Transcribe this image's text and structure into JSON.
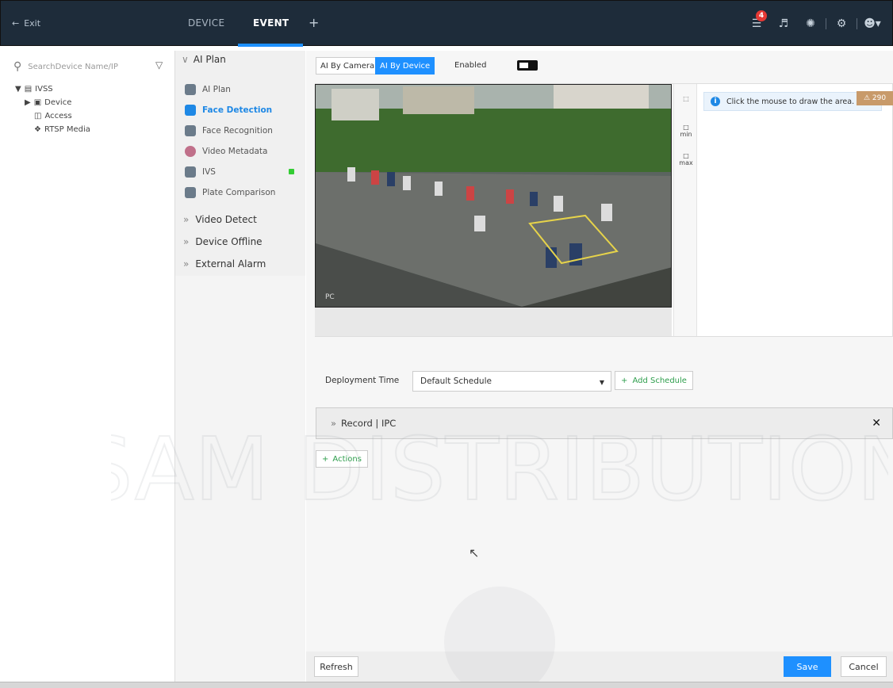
{
  "topbar": {
    "exit_label": "Exit",
    "tabs": [
      {
        "label": "DEVICE",
        "active": false
      },
      {
        "label": "EVENT",
        "active": true
      }
    ],
    "notification_count": "4"
  },
  "left_panel": {
    "search_placeholder": "SearchDevice Name/IP",
    "tree": {
      "root": "IVSS",
      "items": [
        "Device",
        "Access",
        "RTSP Media"
      ]
    }
  },
  "mid_panel": {
    "ai_plan_header": "AI Plan",
    "menu": [
      {
        "label": "AI Plan",
        "icon": "ai-plan-icon"
      },
      {
        "label": "Face Detection",
        "icon": "face-detection-icon",
        "active": true
      },
      {
        "label": "Face Recognition",
        "icon": "face-recognition-icon"
      },
      {
        "label": "Video Metadata",
        "icon": "video-metadata-icon"
      },
      {
        "label": "IVS",
        "icon": "ivs-icon"
      },
      {
        "label": "Plate Comparison",
        "icon": "plate-comparison-icon"
      }
    ],
    "sections": [
      "Video Detect",
      "Device Offline",
      "External Alarm"
    ]
  },
  "main": {
    "mode_tabs": [
      {
        "label": "AI By Camera",
        "active": false
      },
      {
        "label": "AI By Device",
        "active": true
      }
    ],
    "enabled_label": "Enabled",
    "tools": [
      {
        "label": "",
        "icon": "draw-rule-icon"
      },
      {
        "label": "min",
        "icon": "min-size-icon"
      },
      {
        "label": "max",
        "icon": "max-size-icon"
      }
    ],
    "tip": "Click the mouse to draw the area.",
    "warning_label": "290",
    "deployment_label": "Deployment Time",
    "schedule_value": "Default Schedule",
    "add_schedule_label": "Add Schedule",
    "record_label": "Record | IPC",
    "actions_label": "Actions",
    "refresh_label": "Refresh",
    "save_label": "Save",
    "cancel_label": "Cancel"
  },
  "watermark": "SAM DISTRIBUTION"
}
